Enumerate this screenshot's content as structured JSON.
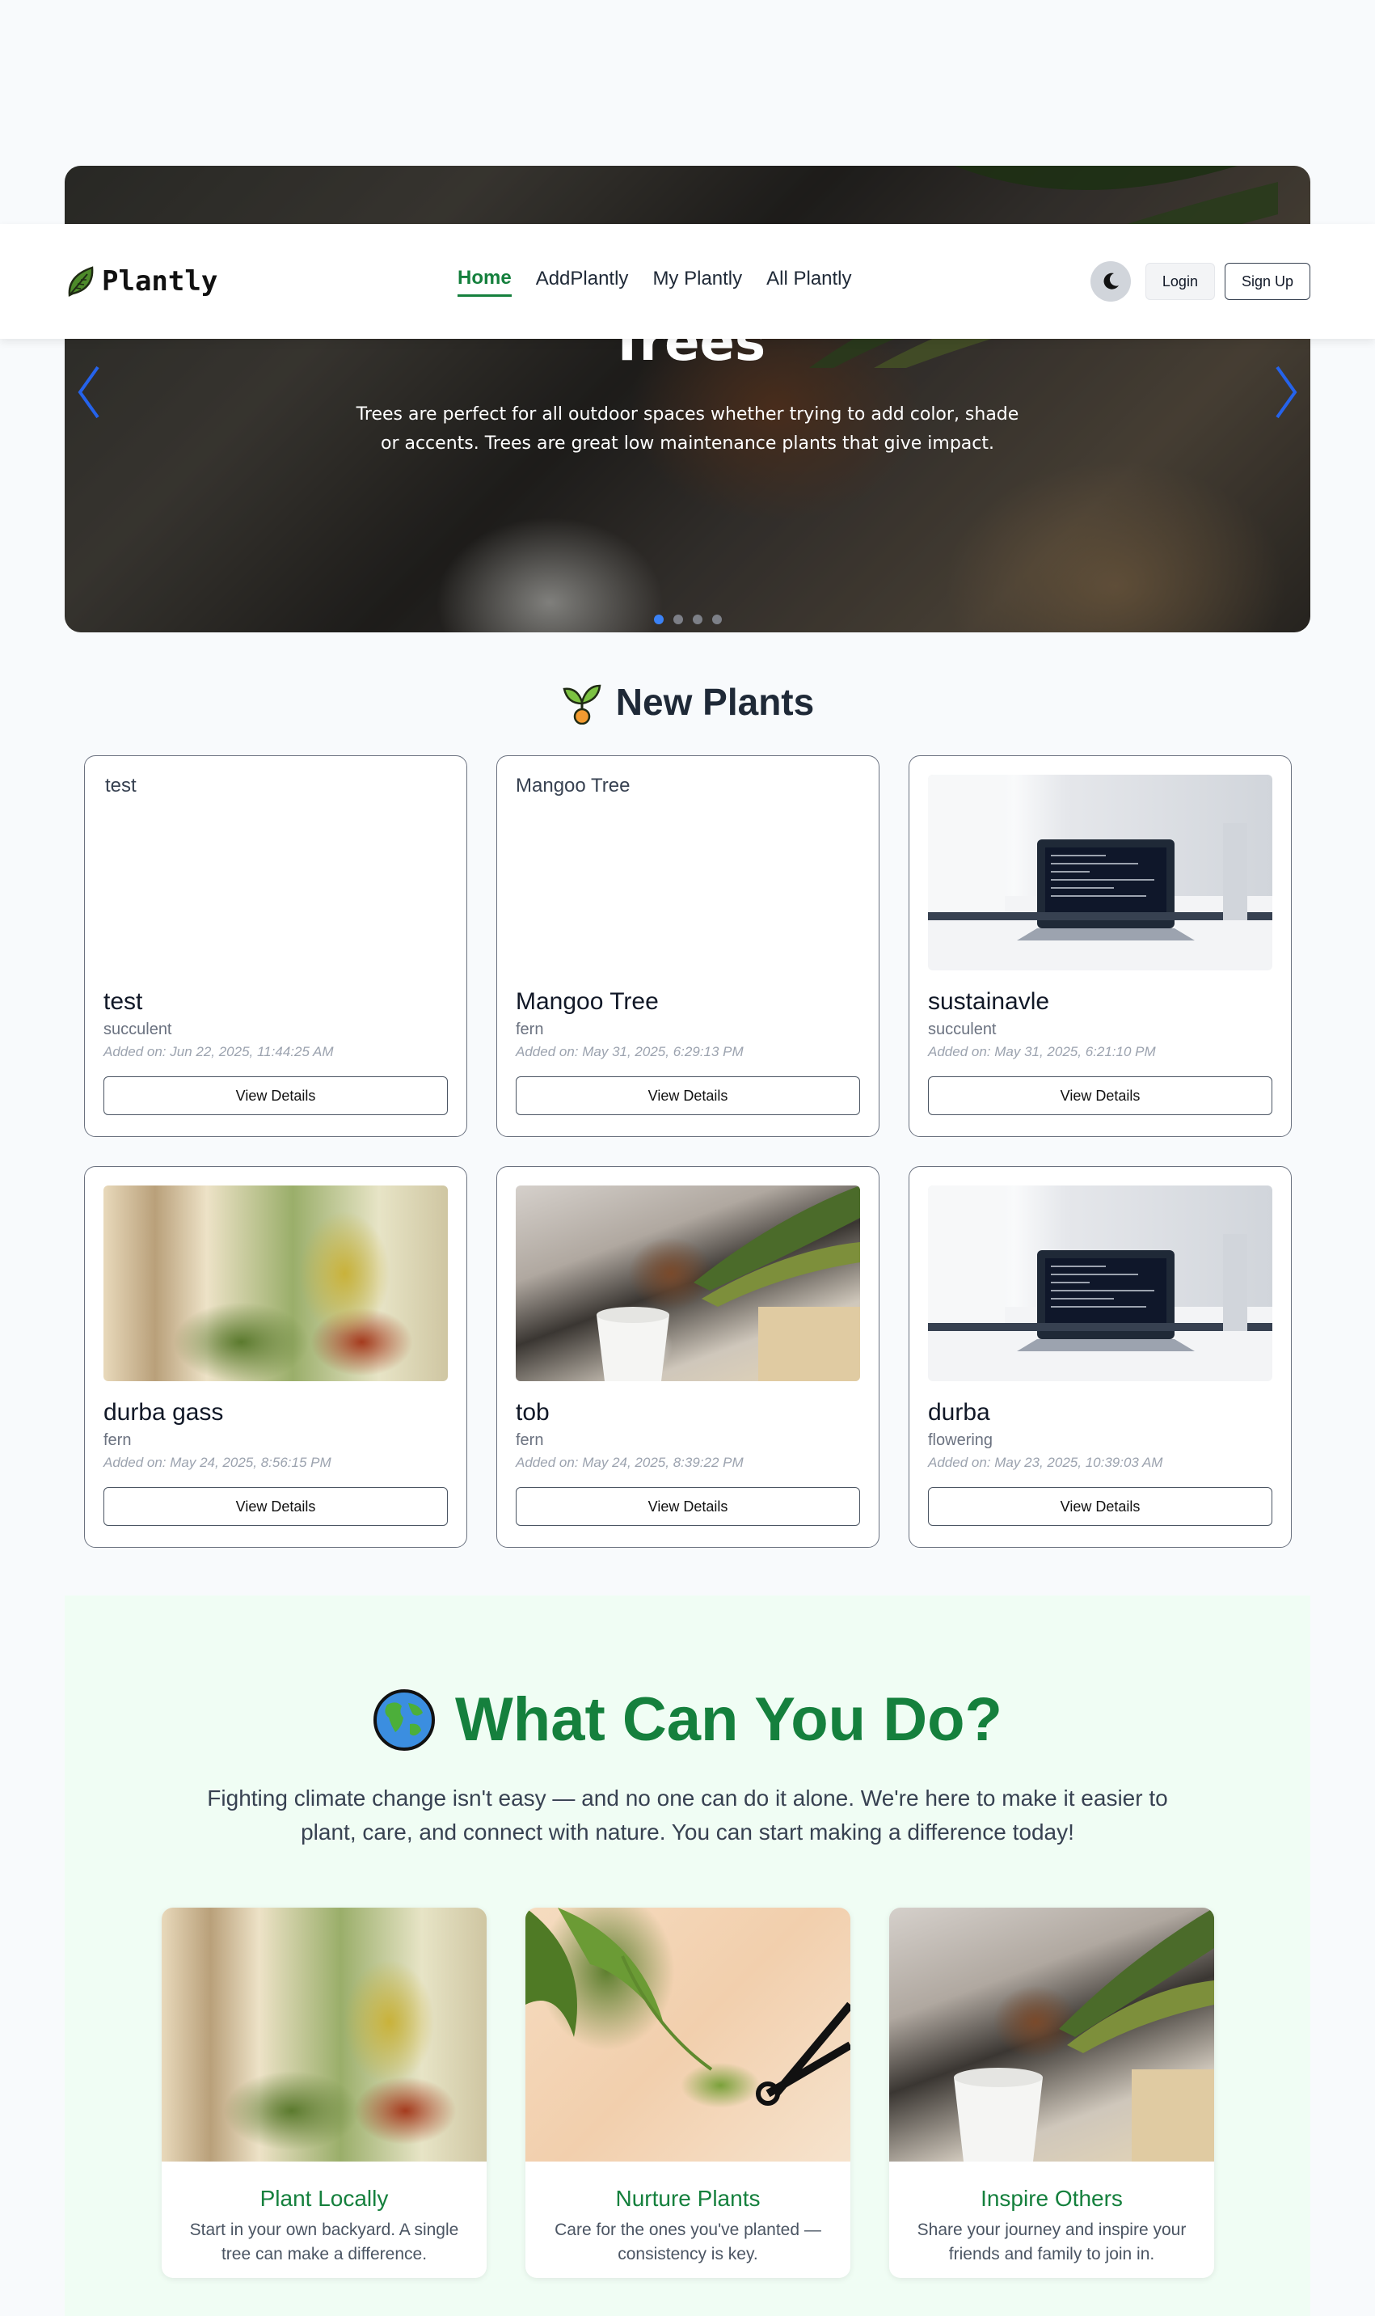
{
  "brand": {
    "name": "Plantly",
    "logo_icon": "leaf-icon"
  },
  "nav": {
    "links": [
      {
        "label": "Home",
        "active": true
      },
      {
        "label": "AddPlantly",
        "active": false
      },
      {
        "label": "My Plantly",
        "active": false
      },
      {
        "label": "All Plantly",
        "active": false
      }
    ],
    "theme_icon": "moon-icon",
    "login_label": "Login",
    "signup_label": "Sign Up"
  },
  "hero": {
    "title": "Trees",
    "description": "Trees are perfect for all outdoor spaces whether trying to add color, shade or accents. Trees are great low maintenance plants that give impact.",
    "slide_count": 4,
    "active_slide": 0
  },
  "new_plants": {
    "title": "New Plants",
    "title_icon": "seedling-icon",
    "cards": [
      {
        "name": "test",
        "type": "succulent",
        "date": "Added on: Jun 22, 2025, 11:44:25 AM",
        "image_alt": "test",
        "image": "broken",
        "button": "View Details"
      },
      {
        "name": "Mangoo Tree",
        "type": "fern",
        "date": "Added on: May 31, 2025, 6:29:13 PM",
        "image_alt": "Mangoo Tree",
        "image": "broken",
        "button": "View Details"
      },
      {
        "name": "sustainavle",
        "type": "succulent",
        "date": "Added on: May 31, 2025, 6:21:10 PM",
        "image_alt": "sustainavle",
        "image": "laptop",
        "button": "View Details"
      },
      {
        "name": "durba gass",
        "type": "fern",
        "date": "Added on: May 24, 2025, 8:56:15 PM",
        "image_alt": "durba gass",
        "image": "plants",
        "button": "View Details"
      },
      {
        "name": "tob",
        "type": "fern",
        "date": "Added on: May 24, 2025, 8:39:22 PM",
        "image_alt": "tob",
        "image": "repot",
        "button": "View Details"
      },
      {
        "name": "durba",
        "type": "flowering",
        "date": "Added on: May 23, 2025, 10:39:03 AM",
        "image_alt": "durba",
        "image": "laptop",
        "button": "View Details"
      }
    ]
  },
  "what_can_you_do": {
    "title": "What Can You Do?",
    "title_icon": "globe-icon",
    "description": "Fighting climate change isn't easy — and no one can do it alone. We're here to make it easier to plant, care, and connect with nature. You can start making a difference today!",
    "cards": [
      {
        "title": "Plant Locally",
        "text": "Start in your own backyard. A single tree can make a difference.",
        "image": "plants"
      },
      {
        "title": "Nurture Plants",
        "text": "Care for the ones you've planted — consistency is key.",
        "image": "prune"
      },
      {
        "title": "Inspire Others",
        "text": "Share your journey and inspire your friends and family to join in.",
        "image": "repot"
      }
    ]
  },
  "colors": {
    "brand_green": "#15803d",
    "accent_blue": "#3b82f6",
    "section_bg": "#f0fdf4"
  }
}
